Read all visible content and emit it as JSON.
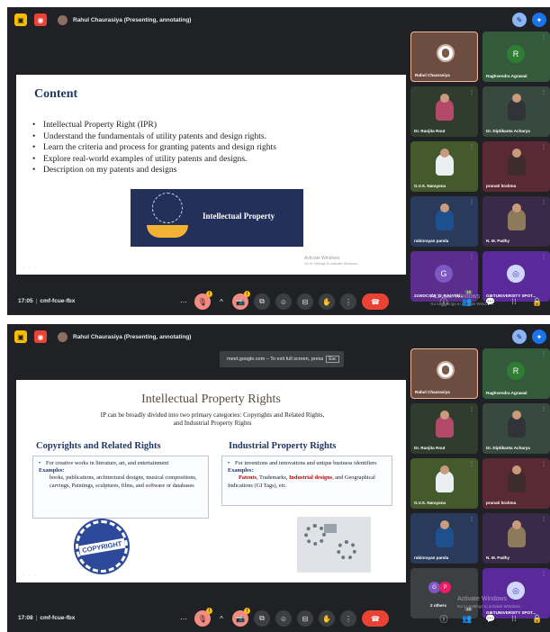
{
  "screen1": {
    "time": "17:05",
    "meeting_code": "cmf-fcue-fbx",
    "presenter_label": "Rahul Chaurasiya (Presenting, annotating)",
    "slide": {
      "title": "Content",
      "bullets": [
        "Intellectual Property Right (IPR)",
        "Understand the fundamentals of utility patents and design rights.",
        "Learn the criteria and process for granting patents and design rights",
        "Explore real-world examples of utility patents and designs.",
        "Description on my patents and designs"
      ],
      "banner_label": "Intellectual Property",
      "activate_small": "Activate Windows",
      "activate_small_sub": "Go to Settings to activate Windows."
    },
    "participants": [
      {
        "name": "Rahul Chaurasiya",
        "bg": "#6d4c41",
        "type": "presenter"
      },
      {
        "name": "Raghvendra Agrawal",
        "bg": "#335a3a",
        "type": "initial",
        "initial": "R",
        "circle": "#2e7d32"
      },
      {
        "name": "Dr. Ranjita Rout",
        "bg": "#2f3c2e",
        "type": "cam",
        "shirt": "#b44a6a"
      },
      {
        "name": "Dr. Diptikanta Acharya",
        "bg": "#384a40",
        "type": "cam",
        "shirt": "#303438"
      },
      {
        "name": "G.V.S. Narayana",
        "bg": "#445a2c",
        "type": "cam",
        "shirt": "#eceff1"
      },
      {
        "name": "pranati brahma",
        "bg": "#5a2a34",
        "type": "cam",
        "shirt": "#3e2b2b"
      },
      {
        "name": "rabinrayan panda",
        "bg": "#2a3a5a",
        "type": "cam",
        "shirt": "#1e4f8f"
      },
      {
        "name": "N. M. Padhy",
        "bg": "#3a2a4a",
        "type": "cam",
        "shirt": "#8d7a5a"
      },
      {
        "name": "21WDCS05_G_KALYAN...",
        "bg": "#5b2d8c",
        "type": "initial",
        "initial": "G",
        "circle": "#7e57c2"
      },
      {
        "name": "GIETUNIVERSITY SPOT...",
        "bg": "#5a2a9a",
        "type": "initial",
        "initial": "◎",
        "circle": "#d0d8ff"
      }
    ],
    "activate_windows": "Activate Windows",
    "activate_windows_sub": "Go to Settings to activate Windows.",
    "people_count": "19"
  },
  "screen2": {
    "time": "17:08",
    "meeting_code": "cmf-fcue-fbx",
    "presenter_label": "Rahul Chaurasiya (Presenting, annotating)",
    "fullscreen_toast": "meet.google.com – To exit full screen, press",
    "esc_key": "Esc",
    "slide": {
      "title": "Intellectual Property Rights",
      "subtitle": "IP can be broadly divided into two primary categories: Copyrights and Related Rights, and Industrial Property Rights",
      "left_heading": "Copyrights and Related Rights",
      "left_bullet": "For creative works in literature, art, and entertainment",
      "left_examples_label": "Examples:",
      "left_examples": "books, publications, architectural designs, musical compositions, carvings, Paintings, sculptures, films, and software or databases",
      "right_heading": "Industrial Property Rights",
      "right_bullet": "For inventions and innovations and unique business identifiers",
      "right_examples_label": "Examples:",
      "right_ex_patents": "Patents",
      "right_ex_trademarks": ", Trademarks, ",
      "right_ex_designs": "Industrial designs",
      "right_ex_rest": ", and Geographical Indications (GI Tags), etc.",
      "copyright_seal": "COPYRIGHT"
    },
    "participants": [
      {
        "name": "Rahul Chaurasiya",
        "bg": "#6d4c41",
        "type": "presenter"
      },
      {
        "name": "Raghvendra Agrawal",
        "bg": "#335a3a",
        "type": "initial",
        "initial": "R",
        "circle": "#2e7d32"
      },
      {
        "name": "Dr. Ranjita Rout",
        "bg": "#2f3c2e",
        "type": "cam",
        "shirt": "#b44a6a"
      },
      {
        "name": "Dr. Diptikanta Acharya",
        "bg": "#384a40",
        "type": "cam",
        "shirt": "#303438"
      },
      {
        "name": "G.V.S. Narayana",
        "bg": "#445a2c",
        "type": "cam",
        "shirt": "#eceff1"
      },
      {
        "name": "pranati brahma",
        "bg": "#5a2a34",
        "type": "cam",
        "shirt": "#3e2b2b"
      },
      {
        "name": "rabinrayan panda",
        "bg": "#2a3a5a",
        "type": "cam",
        "shirt": "#1e4f8f"
      },
      {
        "name": "N. M. Padhy",
        "bg": "#3a2a4a",
        "type": "cam",
        "shirt": "#8d7a5a"
      },
      {
        "name": "2 others",
        "bg": "#3c4043",
        "type": "others",
        "initials": [
          "G",
          "P"
        ]
      },
      {
        "name": "GIETUNIVERSITY SPOT...",
        "bg": "#5a2a9a",
        "type": "initial",
        "initial": "◎",
        "circle": "#d0d8ff"
      }
    ],
    "activate_windows": "Activate Windows",
    "activate_windows_sub": "Go to Settings to activate Windows.",
    "people_count": "19"
  },
  "icons": {
    "screen_share": "▣",
    "record": "◉",
    "mic": "🎙",
    "camera": "📷",
    "present": "⧉",
    "emoji": "☺",
    "captions": "⊟",
    "hand": "✋",
    "more": "⋮",
    "end_call": "☎",
    "info": "ⓘ",
    "people": "👥",
    "chat": "💬",
    "activities": "⁝⁝",
    "lock": "🔒"
  },
  "colors": {
    "meet_bg": "#202124",
    "end_call": "#ea4335",
    "accent": "#8ab4f8",
    "slide_title": "#1f3864"
  }
}
